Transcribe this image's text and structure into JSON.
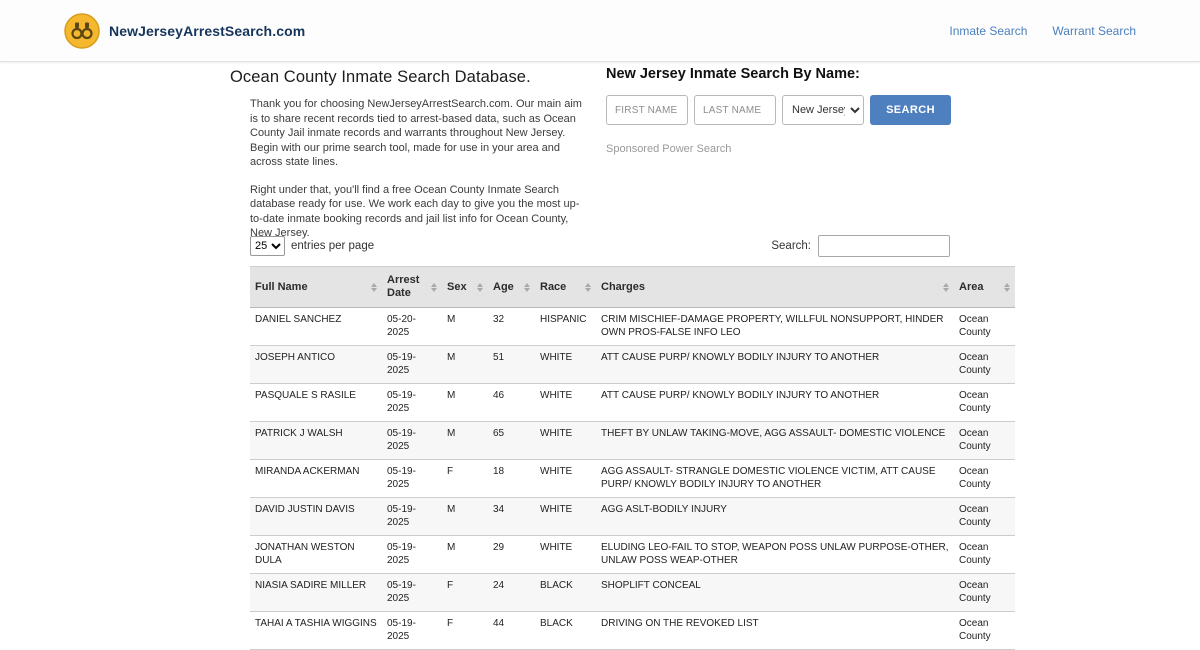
{
  "colors": {
    "accent_blue": "#4e7fbe",
    "logo_yellow": "#f5b72e",
    "logo_text_navy": "#16355c",
    "table_header_gray": "#e4e4e4"
  },
  "header": {
    "site_name": "NewJerseyArrestSearch.com",
    "nav": [
      {
        "label": "Inmate Search"
      },
      {
        "label": "Warrant Search"
      }
    ]
  },
  "intro": {
    "title": "Ocean County Inmate Search Database.",
    "paragraph1": "Thank you for choosing NewJerseyArrestSearch.com. Our main aim is to share recent records tied to arrest-based data, such as Ocean County Jail inmate records and warrants throughout New Jersey. Begin with our prime search tool, made for use in your area and across state lines.",
    "paragraph2": "Right under that, you'll find a free Ocean County Inmate Search database ready for use. We work each day to give you the most up-to-date inmate booking records and jail list info for Ocean County, New Jersey."
  },
  "name_search": {
    "title": "New Jersey Inmate Search By Name:",
    "first_name_placeholder": "FIRST NAME",
    "last_name_placeholder": "LAST NAME",
    "state_selected": "New Jersey",
    "search_button_label": "SEARCH",
    "sponsored_text": "Sponsored Power Search"
  },
  "table_controls": {
    "entries_per_page": "25",
    "entries_label": "entries per page",
    "search_label": "Search:",
    "search_value": ""
  },
  "table": {
    "columns": [
      {
        "key": "full_name",
        "label": "Full Name"
      },
      {
        "key": "arrest_date",
        "label": "Arrest Date"
      },
      {
        "key": "sex",
        "label": "Sex"
      },
      {
        "key": "age",
        "label": "Age"
      },
      {
        "key": "race",
        "label": "Race"
      },
      {
        "key": "charges",
        "label": "Charges"
      },
      {
        "key": "area",
        "label": "Area"
      }
    ],
    "rows": [
      {
        "full_name": "DANIEL SANCHEZ",
        "arrest_date": "05-20-2025",
        "sex": "M",
        "age": "32",
        "race": "HISPANIC",
        "charges": "CRIM MISCHIEF-DAMAGE PROPERTY, WILLFUL NONSUPPORT, HINDER OWN PROS-FALSE INFO LEO",
        "area": "Ocean County"
      },
      {
        "full_name": "JOSEPH ANTICO",
        "arrest_date": "05-19-2025",
        "sex": "M",
        "age": "51",
        "race": "WHITE",
        "charges": "ATT CAUSE PURP/ KNOWLY BODILY INJURY TO ANOTHER",
        "area": "Ocean County"
      },
      {
        "full_name": "PASQUALE S RASILE",
        "arrest_date": "05-19-2025",
        "sex": "M",
        "age": "46",
        "race": "WHITE",
        "charges": "ATT CAUSE PURP/ KNOWLY BODILY INJURY TO ANOTHER",
        "area": "Ocean County"
      },
      {
        "full_name": "PATRICK J WALSH",
        "arrest_date": "05-19-2025",
        "sex": "M",
        "age": "65",
        "race": "WHITE",
        "charges": "THEFT BY UNLAW TAKING-MOVE, AGG ASSAULT- DOMESTIC VIOLENCE",
        "area": "Ocean County"
      },
      {
        "full_name": "MIRANDA ACKERMAN",
        "arrest_date": "05-19-2025",
        "sex": "F",
        "age": "18",
        "race": "WHITE",
        "charges": "AGG ASSAULT- STRANGLE DOMESTIC VIOLENCE VICTIM, ATT CAUSE PURP/ KNOWLY BODILY INJURY TO ANOTHER",
        "area": "Ocean County"
      },
      {
        "full_name": "DAVID JUSTIN DAVIS",
        "arrest_date": "05-19-2025",
        "sex": "M",
        "age": "34",
        "race": "WHITE",
        "charges": "AGG ASLT-BODILY INJURY",
        "area": "Ocean County"
      },
      {
        "full_name": "JONATHAN WESTON DULA",
        "arrest_date": "05-19-2025",
        "sex": "M",
        "age": "29",
        "race": "WHITE",
        "charges": "ELUDING LEO-FAIL TO STOP, WEAPON POSS UNLAW PURPOSE-OTHER, UNLAW POSS WEAP-OTHER",
        "area": "Ocean County"
      },
      {
        "full_name": "NIASIA SADIRE MILLER",
        "arrest_date": "05-19-2025",
        "sex": "F",
        "age": "24",
        "race": "BLACK",
        "charges": "SHOPLIFT CONCEAL",
        "area": "Ocean County"
      },
      {
        "full_name": "TAHAI A TASHIA WIGGINS",
        "arrest_date": "05-19-2025",
        "sex": "F",
        "age": "44",
        "race": "BLACK",
        "charges": "DRIVING ON THE REVOKED LIST",
        "area": "Ocean County"
      }
    ]
  }
}
